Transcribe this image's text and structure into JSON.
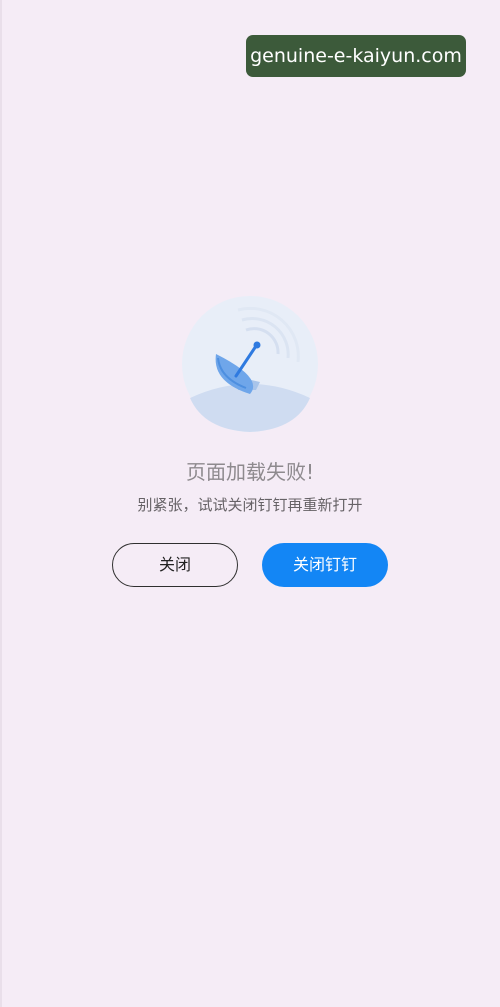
{
  "watermark": {
    "text": "genuine-e-kaiyun.com"
  },
  "error": {
    "illustration_icon": "satellite-dish-icon",
    "title": "页面加载失败!",
    "subtitle": "别紧张，试试关闭钉钉再重新打开"
  },
  "actions": {
    "close_label": "关闭",
    "close_dingtalk_label": "关闭钉钉"
  },
  "colors": {
    "background": "#f5ecf6",
    "primary": "#1386f5",
    "watermark_bg": "#3c5a3a"
  }
}
